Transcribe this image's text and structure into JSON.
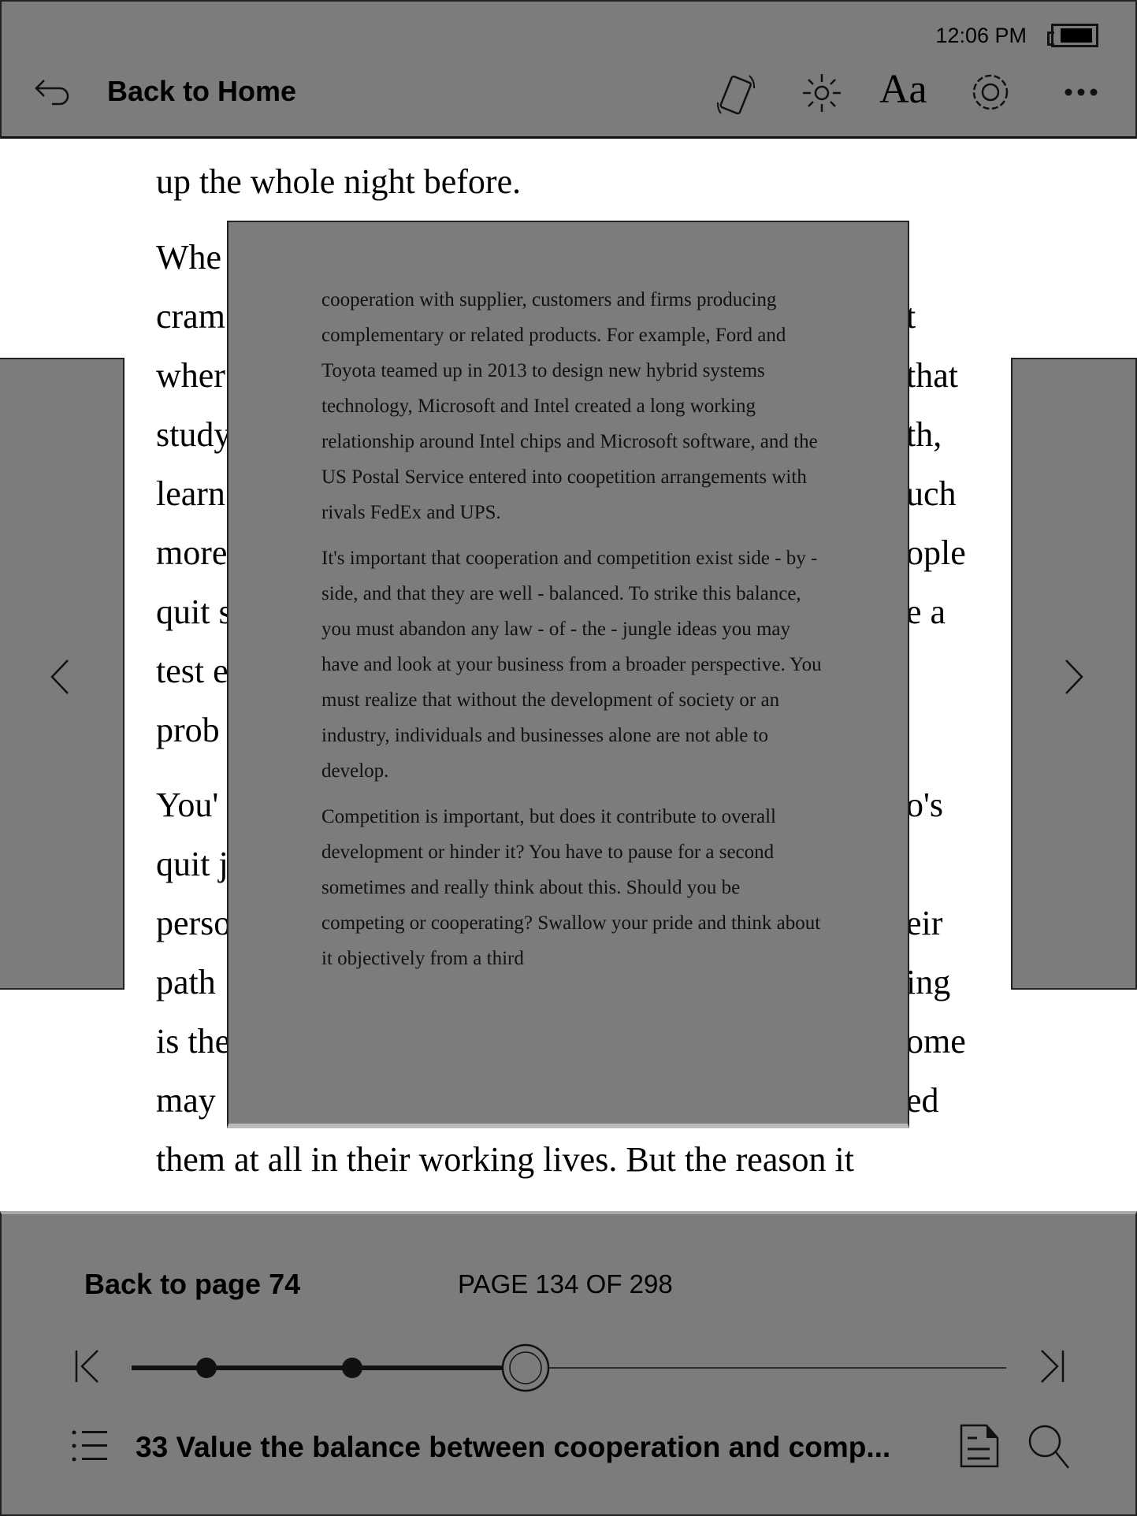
{
  "status": {
    "time": "12:06 PM",
    "battery_level": 1.0
  },
  "header": {
    "back_label": "Back to Home",
    "icons": [
      "rotate-icon",
      "brightness-icon",
      "font-icon",
      "settings-icon",
      "more-icon"
    ],
    "font_label": "Aa"
  },
  "page": {
    "left_lines": [
      "up the whole night before.",
      "Whe",
      "cram",
      "wher",
      "study",
      "learn",
      "more",
      "quit s",
      "test e",
      "prob",
      "You'",
      "quit j",
      "perso",
      "path",
      "is the",
      "may",
      "them at all in their working lives. But the reason it"
    ],
    "right_lines": [
      "",
      "",
      "t",
      "that",
      "th,",
      "uch",
      "ople",
      "e a",
      "",
      "",
      "o's",
      "",
      "eir",
      "ing",
      "ome",
      "ed",
      ""
    ]
  },
  "popup": {
    "paragraphs": [
      "cooperation with supplier, customers and firms producing complementary or related products. For example, Ford and Toyota teamed up in 2013 to design new hybrid systems technology, Microsoft and Intel created a long working relationship around Intel chips and Microsoft software, and the US Postal Service entered into coopetition arrangements with rivals FedEx and UPS.",
      "It's important that cooperation and competition exist side - by - side, and that they are well - balanced. To strike this balance, you must abandon any law - of - the - jungle ideas you may have and look at your business from a broader perspective. You must realize that without the development of society or an industry, individuals and businesses alone are not able to develop.",
      "Competition is important, but does it contribute to overall development or hinder it? You have to pause for a second sometimes and really think about this. Should you be competing or cooperating? Swallow your pride and think about it objectively from a third"
    ]
  },
  "footer": {
    "back_to_page": "Back to page 74",
    "page_indicator": "PAGE 134 OF 298",
    "current_page": 134,
    "total_pages": 298,
    "chapter_title": "33 Value the balance between cooperation and comp..."
  }
}
